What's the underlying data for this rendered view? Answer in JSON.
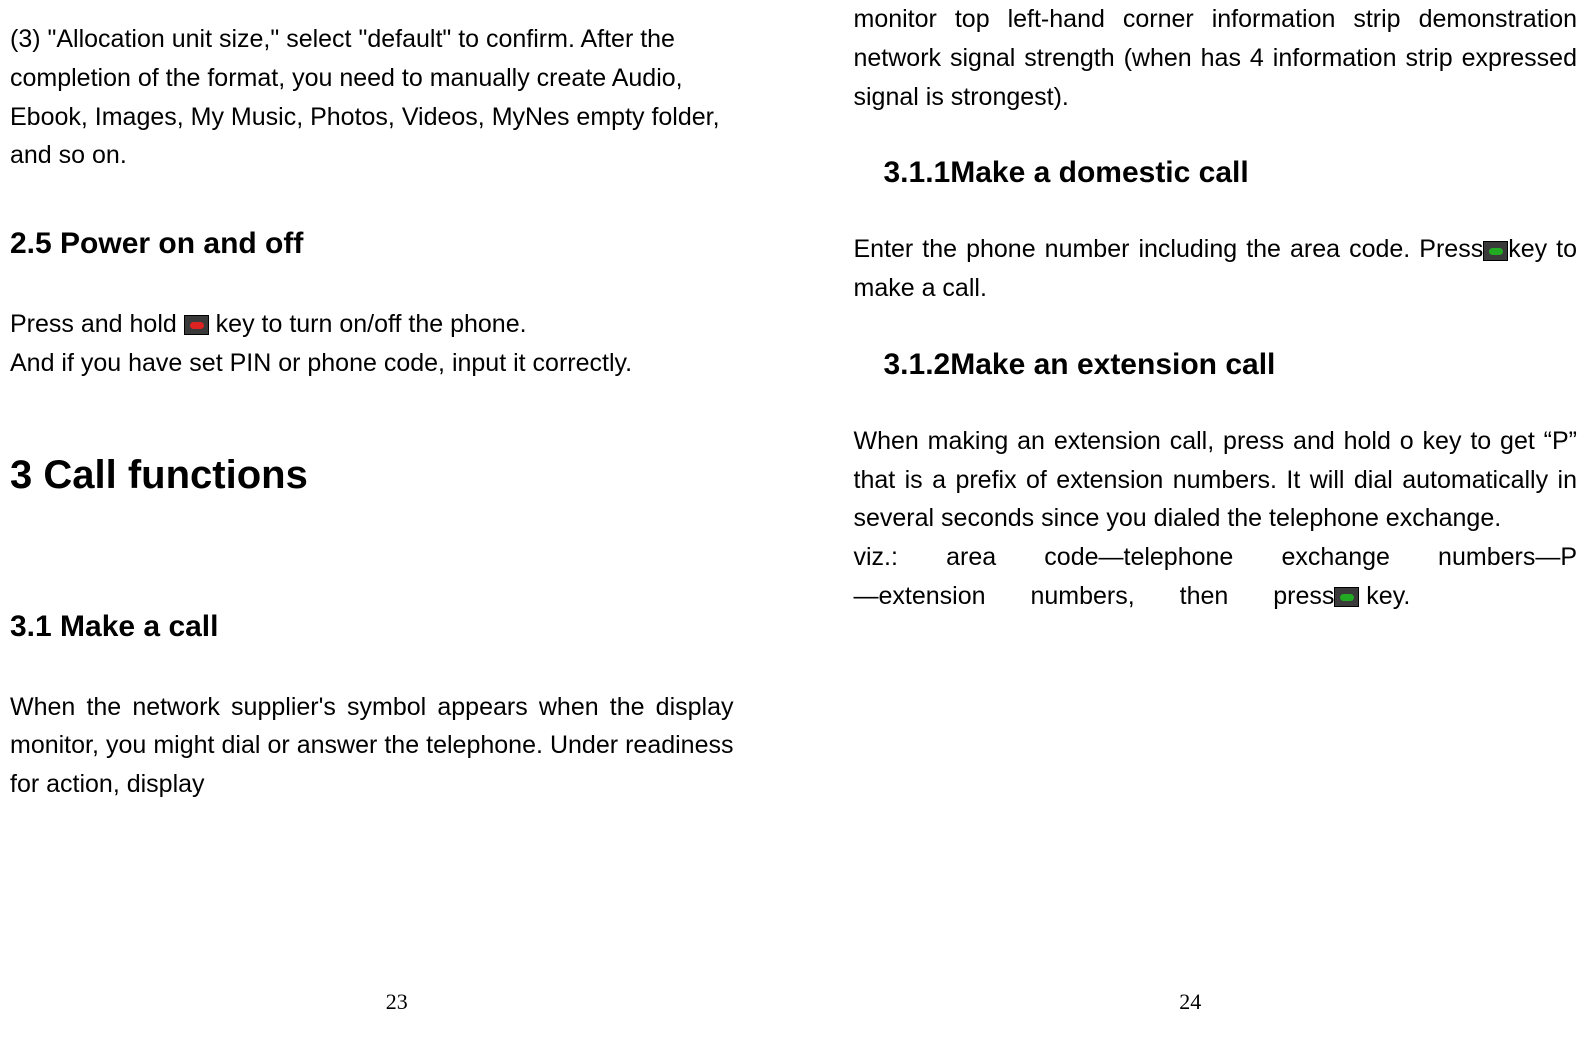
{
  "left": {
    "p1": "(3) \"Allocation unit size,\" select \"default\" to confirm. After the completion of the format, you need to manually create Audio, Ebook, Images, My Music, Photos, Videos, MyNes empty folder, and so on.",
    "h2_5": "2.5 Power on and off",
    "p2a": "Press and hold ",
    "p2b": "key to turn on/off the phone.",
    "p3": "And if you have set PIN or phone code, input it correctly.",
    "h3": "3 Call functions",
    "h3_1": "3.1 Make a call",
    "p4": "When the network supplier's symbol appears when the display monitor, you might dial or answer the telephone. Under readiness for action, display",
    "pagenum": "23"
  },
  "right": {
    "p0": "monitor top left-hand corner information strip demonstration network signal strength (when has 4 information strip expressed signal is strongest).",
    "h311": "3.1.1Make a domestic call",
    "p1a": "Enter the phone number including the area code. Press",
    "p1b": "key to make a call.",
    "h312": "3.1.2Make an extension call",
    "p2": "When making an extension call, press and hold o key to get “P” that is a prefix of extension numbers. It will dial automatically in several seconds since you dialed the telephone exchange.",
    "p3a": "viz.: area code—telephone exchange numbers—P—extension numbers, then press",
    "p3b": " key.",
    "pagenum": "24"
  }
}
